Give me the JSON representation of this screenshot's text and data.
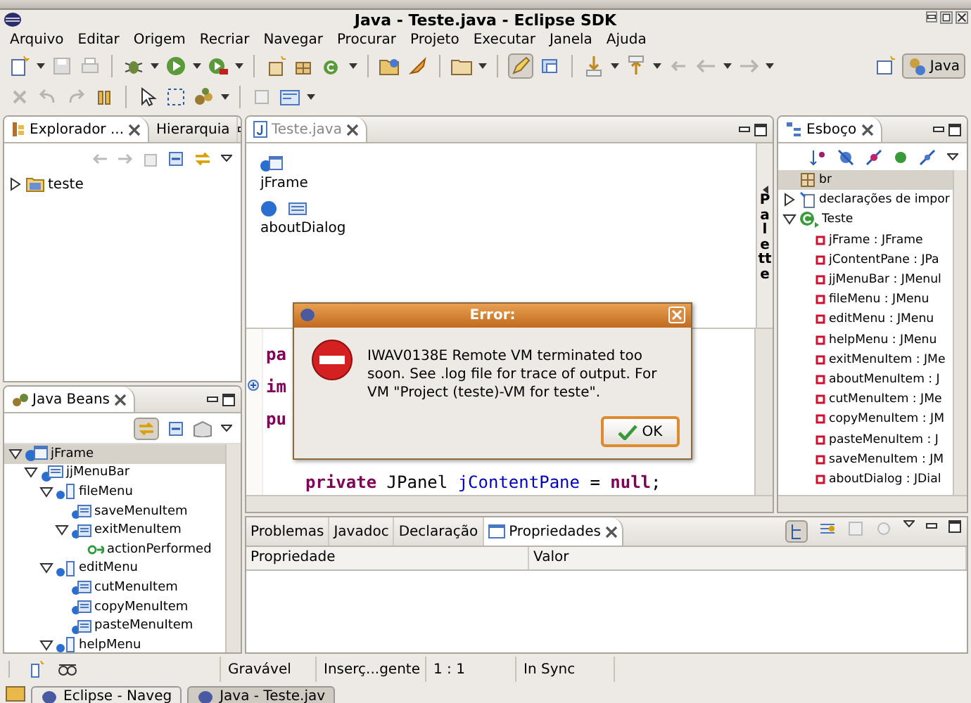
{
  "window": {
    "title": "Java - Teste.java - Eclipse SDK"
  },
  "menu": [
    "Arquivo",
    "Editar",
    "Origem",
    "Recriar",
    "Navegar",
    "Procurar",
    "Projeto",
    "Executar",
    "Janela",
    "Ajuda"
  ],
  "perspective": {
    "label": "Java",
    "selected": true
  },
  "explorer": {
    "tabs": [
      {
        "label": "Explorador ...",
        "selected": true
      },
      {
        "label": "Hierarquia",
        "selected": false
      }
    ],
    "tree": [
      {
        "label": "teste",
        "kind": "project",
        "expanded": false,
        "selected": false
      }
    ]
  },
  "beans": {
    "tabs": [
      {
        "label": "Java Beans",
        "selected": true
      }
    ],
    "tree": [
      {
        "label": "jFrame",
        "kind": "frame",
        "expanded": true,
        "selected": true,
        "children": [
          {
            "label": "jjMenuBar",
            "kind": "menubar",
            "expanded": true,
            "selected": false,
            "children": [
              {
                "label": "fileMenu",
                "kind": "menu",
                "expanded": true,
                "selected": false,
                "children": [
                  {
                    "label": "saveMenuItem",
                    "kind": "menuitem",
                    "selected": false
                  },
                  {
                    "label": "exitMenuItem",
                    "kind": "menuitem",
                    "expanded": true,
                    "selected": false,
                    "children": [
                      {
                        "label": "actionPerformed",
                        "kind": "event",
                        "selected": false
                      }
                    ]
                  }
                ]
              },
              {
                "label": "editMenu",
                "kind": "menu",
                "expanded": true,
                "selected": false,
                "children": [
                  {
                    "label": "cutMenuItem",
                    "kind": "menuitem",
                    "selected": false
                  },
                  {
                    "label": "copyMenuItem",
                    "kind": "menuitem",
                    "selected": false
                  },
                  {
                    "label": "pasteMenuItem",
                    "kind": "menuitem",
                    "selected": false
                  }
                ]
              },
              {
                "label": "helpMenu",
                "kind": "menu",
                "expanded": true,
                "selected": false
              }
            ]
          }
        ]
      }
    ]
  },
  "editor": {
    "tab": "Teste.java",
    "design": [
      {
        "label": "jFrame",
        "kind": "frame"
      },
      {
        "label": "aboutDialog",
        "kind": "dialog"
      }
    ],
    "palette": "Palette",
    "code": [
      {
        "fold": false,
        "tokens": [
          {
            "text": "pa",
            "kind": "keyword"
          }
        ]
      },
      {
        "fold": true,
        "tokens": [
          {
            "text": "im",
            "kind": "keyword"
          }
        ]
      },
      {
        "fold": false,
        "tokens": [
          {
            "text": "pu",
            "kind": "keyword"
          }
        ]
      },
      {
        "fold": false,
        "tokens": [
          {
            "text": "private",
            "kind": "keyword"
          },
          {
            "text": "JPanel",
            "kind": "plain"
          },
          {
            "text": "jContentPane",
            "kind": "field"
          },
          {
            "text": "=",
            "kind": "plain"
          },
          {
            "text": "null",
            "kind": "keyword"
          },
          {
            "text": ";",
            "kind": "punct"
          }
        ]
      }
    ]
  },
  "outline": {
    "tabs": [
      {
        "label": "Esboço",
        "selected": true
      }
    ],
    "tree": [
      {
        "label": "br",
        "kind": "package",
        "selected": true
      },
      {
        "label": "declarações de impor",
        "kind": "imports",
        "expanded": false,
        "selected": false
      },
      {
        "label": "Teste",
        "kind": "class",
        "expanded": true,
        "selected": false,
        "children": [
          {
            "label": "jFrame : JFrame",
            "kind": "field",
            "selected": false
          },
          {
            "label": "jContentPane : JPa",
            "kind": "field",
            "selected": false
          },
          {
            "label": "jjMenuBar : JMenul",
            "kind": "field",
            "selected": false
          },
          {
            "label": "fileMenu : JMenu",
            "kind": "field",
            "selected": false
          },
          {
            "label": "editMenu : JMenu",
            "kind": "field",
            "selected": false
          },
          {
            "label": "helpMenu : JMenu",
            "kind": "field",
            "selected": false
          },
          {
            "label": "exitMenuItem : JMe",
            "kind": "field",
            "selected": false
          },
          {
            "label": "aboutMenuItem : J",
            "kind": "field",
            "selected": false
          },
          {
            "label": "cutMenuItem : JMe",
            "kind": "field",
            "selected": false
          },
          {
            "label": "copyMenuItem : JM",
            "kind": "field",
            "selected": false
          },
          {
            "label": "pasteMenuItem : J",
            "kind": "field",
            "selected": false
          },
          {
            "label": "saveMenuItem : JM",
            "kind": "field",
            "selected": false
          },
          {
            "label": "aboutDialog : JDial",
            "kind": "field",
            "selected": false
          }
        ]
      }
    ]
  },
  "bottom": {
    "tabs": [
      {
        "label": "Problemas",
        "selected": false
      },
      {
        "label": "Javadoc",
        "selected": false
      },
      {
        "label": "Declaração",
        "selected": false
      },
      {
        "label": "Propriedades",
        "selected": true
      }
    ],
    "columns": [
      "Propriedade",
      "Valor"
    ]
  },
  "status": [
    "Gravável",
    "Inserç...gente",
    "1 : 1",
    "In Sync"
  ],
  "taskbar": [
    {
      "label": "Eclipse - Naveg",
      "selected": false
    },
    {
      "label": "Java - Teste.jav",
      "selected": true
    }
  ],
  "dialog": {
    "title": "Error:",
    "message": "IWAV0138E Remote VM terminated too soon. See .log file for trace of output. For VM \"Project (teste)-VM for teste\".",
    "button": "OK"
  }
}
